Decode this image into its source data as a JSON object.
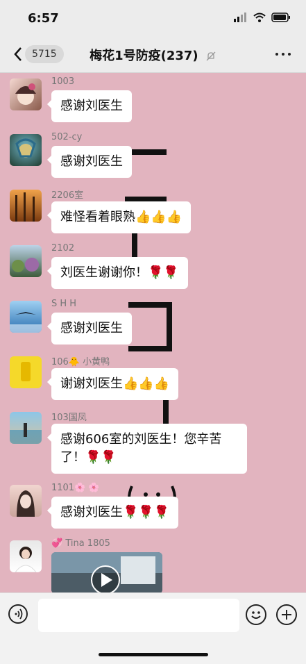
{
  "status": {
    "time": "6:57"
  },
  "nav": {
    "unread_count": "5715",
    "title": "梅花1号防疫(237)"
  },
  "messages": [
    {
      "sender": "1003",
      "text": "感谢刘医生"
    },
    {
      "sender": "502-cy",
      "text": "感谢刘医生"
    },
    {
      "sender": "2206室",
      "text": "难怪看着眼熟👍👍👍"
    },
    {
      "sender": "2102",
      "text": "刘医生谢谢你！🌹🌹"
    },
    {
      "sender": "S H H",
      "text": "感谢刘医生"
    },
    {
      "sender": "106🐥 小黄鸭",
      "text": "谢谢刘医生👍👍👍"
    },
    {
      "sender": "103国凤",
      "text": "感谢606室的刘医生！您辛苦了！🌹🌹"
    },
    {
      "sender": "1101🌸 🌸",
      "text": "感谢刘医生🌹🌹🌹"
    },
    {
      "sender": "💞 Tina 1805",
      "text": ""
    }
  ],
  "colors": {
    "chat_bg": "#e2b4bf",
    "bar_bg": "#ececec",
    "bubble_bg": "#ffffff"
  },
  "icons": [
    "back-arrow-icon",
    "mute-bell-icon",
    "more-dots-icon",
    "voice-icon",
    "emoji-icon",
    "plus-icon",
    "play-icon"
  ]
}
